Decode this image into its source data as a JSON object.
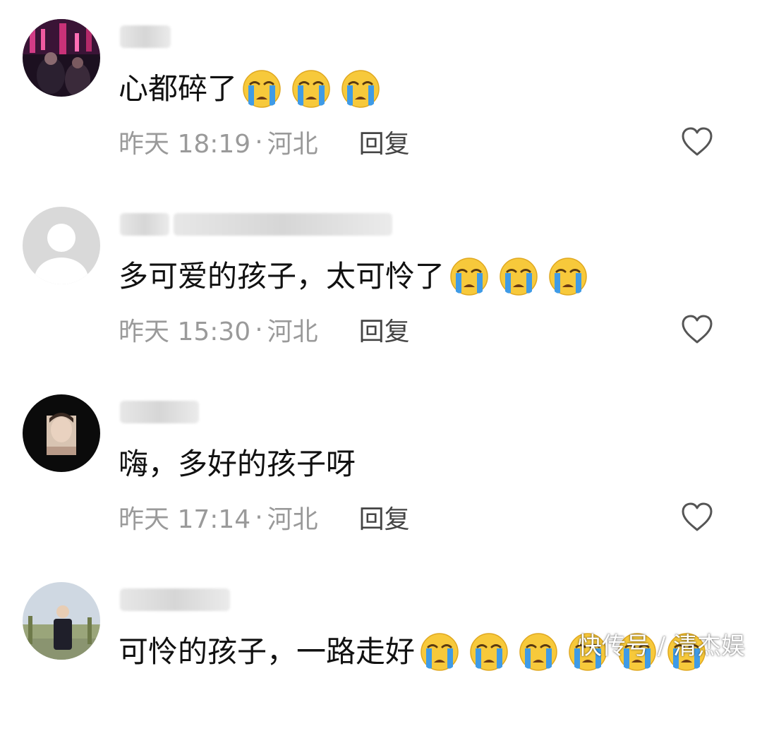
{
  "comments": [
    {
      "text": "心都碎了",
      "emoji_count": 3,
      "date": "昨天 18:19",
      "location": "河北",
      "reply_label": "回复",
      "avatar": "nightlife-photo-avatar"
    },
    {
      "text": "多可爱的孩子，太可怜了",
      "emoji_count": 3,
      "date": "昨天 15:30",
      "location": "河北",
      "reply_label": "回复",
      "avatar": "default-person-avatar"
    },
    {
      "text": "嗨，多好的孩子呀",
      "emoji_count": 0,
      "date": "昨天 17:14",
      "location": "河北",
      "reply_label": "回复",
      "avatar": "woman-portrait-avatar"
    },
    {
      "text": "可怜的孩子，一路走好",
      "emoji_count": 6,
      "avatar": "man-outdoor-avatar"
    }
  ],
  "separator": "·",
  "watermark": "快传号 / 清杰娱",
  "icons": {
    "emoji": "loudly-crying-face-icon",
    "like": "heart-outline-icon"
  },
  "colors": {
    "meta": "#9a9a9a",
    "reply": "#444444",
    "emoji_face": "#f7c93b",
    "emoji_tears": "#3f9be6"
  }
}
